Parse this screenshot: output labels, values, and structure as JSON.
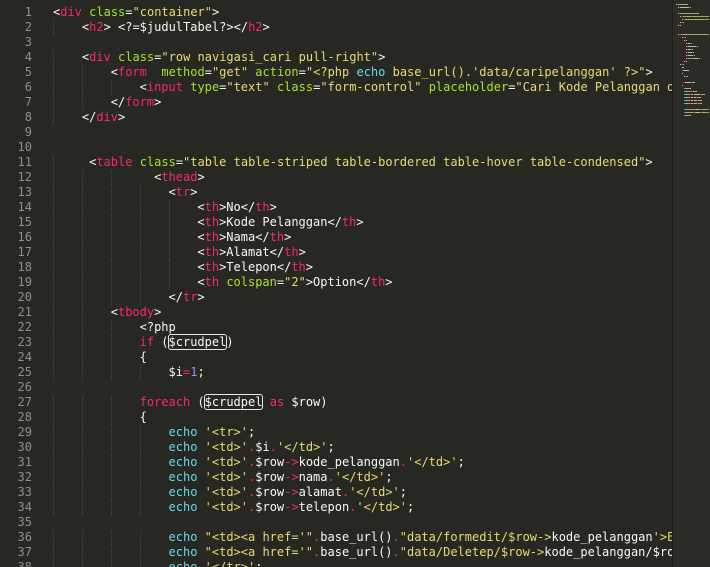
{
  "editor": {
    "lines": [
      {
        "n": "1",
        "indent": 0,
        "tokens": [
          [
            "p",
            "<"
          ],
          [
            "t",
            "div"
          ],
          [
            "p",
            " "
          ],
          [
            "a",
            "class"
          ],
          [
            "p",
            "="
          ],
          [
            "s",
            "\"container\""
          ],
          [
            "p",
            ">"
          ]
        ]
      },
      {
        "n": "2",
        "indent": 1,
        "tokens": [
          [
            "p",
            "<"
          ],
          [
            "t",
            "h2"
          ],
          [
            "p",
            "> <?=$judulTabel?></"
          ],
          [
            "t",
            "h2"
          ],
          [
            "p",
            ">"
          ]
        ]
      },
      {
        "n": "3",
        "indent": 0,
        "tokens": []
      },
      {
        "n": "4",
        "indent": 1,
        "tokens": [
          [
            "p",
            "<"
          ],
          [
            "t",
            "div"
          ],
          [
            "p",
            " "
          ],
          [
            "a",
            "class"
          ],
          [
            "p",
            "="
          ],
          [
            "s",
            "\"row navigasi_cari pull-right\""
          ],
          [
            "p",
            ">"
          ]
        ]
      },
      {
        "n": "5",
        "indent": 2,
        "tokens": [
          [
            "p",
            "<"
          ],
          [
            "t",
            "form"
          ],
          [
            "p",
            "  "
          ],
          [
            "a",
            "method"
          ],
          [
            "p",
            "="
          ],
          [
            "s",
            "\"get\""
          ],
          [
            "p",
            " "
          ],
          [
            "a",
            "action"
          ],
          [
            "p",
            "="
          ],
          [
            "s",
            "\"<?php "
          ],
          [
            "k",
            "echo"
          ],
          [
            "s",
            " base_url().'data/caripelanggan' ?>\""
          ],
          [
            "p",
            ">"
          ]
        ]
      },
      {
        "n": "6",
        "indent": 3,
        "tokens": [
          [
            "p",
            "<"
          ],
          [
            "t",
            "input"
          ],
          [
            "p",
            " "
          ],
          [
            "a",
            "type"
          ],
          [
            "p",
            "="
          ],
          [
            "s",
            "\"text\""
          ],
          [
            "p",
            " "
          ],
          [
            "a",
            "class"
          ],
          [
            "p",
            "="
          ],
          [
            "s",
            "\"form-control\""
          ],
          [
            "p",
            " "
          ],
          [
            "a",
            "placeholder"
          ],
          [
            "p",
            "="
          ],
          [
            "s",
            "\"Cari Kode Pelanggan di s"
          ]
        ]
      },
      {
        "n": "7",
        "indent": 2,
        "tokens": [
          [
            "p",
            "</"
          ],
          [
            "t",
            "form"
          ],
          [
            "p",
            ">"
          ]
        ]
      },
      {
        "n": "8",
        "indent": 1,
        "tokens": [
          [
            "p",
            "</"
          ],
          [
            "t",
            "div"
          ],
          [
            "p",
            ">"
          ]
        ]
      },
      {
        "n": "9",
        "indent": 0,
        "tokens": []
      },
      {
        "n": "10",
        "indent": 0,
        "tokens": []
      },
      {
        "n": "11",
        "indent": 1,
        "tokens": [
          [
            "p",
            " <"
          ],
          [
            "t",
            "table"
          ],
          [
            "p",
            " "
          ],
          [
            "a",
            "class"
          ],
          [
            "p",
            "="
          ],
          [
            "s",
            "\"table table-striped table-bordered table-hover table-condensed\""
          ],
          [
            "p",
            ">"
          ]
        ]
      },
      {
        "n": "12",
        "indent": 3,
        "tokens": [
          [
            "p",
            "  <"
          ],
          [
            "t",
            "thead"
          ],
          [
            "p",
            ">"
          ]
        ]
      },
      {
        "n": "13",
        "indent": 4,
        "tokens": [
          [
            "p",
            "<"
          ],
          [
            "t",
            "tr"
          ],
          [
            "p",
            ">"
          ]
        ]
      },
      {
        "n": "14",
        "indent": 5,
        "tokens": [
          [
            "p",
            "<"
          ],
          [
            "t",
            "th"
          ],
          [
            "p",
            ">No</"
          ],
          [
            "t",
            "th"
          ],
          [
            "p",
            ">"
          ]
        ]
      },
      {
        "n": "15",
        "indent": 5,
        "tokens": [
          [
            "p",
            "<"
          ],
          [
            "t",
            "th"
          ],
          [
            "p",
            ">Kode Pelanggan</"
          ],
          [
            "t",
            "th"
          ],
          [
            "p",
            ">"
          ]
        ]
      },
      {
        "n": "16",
        "indent": 5,
        "tokens": [
          [
            "p",
            "<"
          ],
          [
            "t",
            "th"
          ],
          [
            "p",
            ">Nama</"
          ],
          [
            "t",
            "th"
          ],
          [
            "p",
            ">"
          ]
        ]
      },
      {
        "n": "17",
        "indent": 5,
        "tokens": [
          [
            "p",
            "<"
          ],
          [
            "t",
            "th"
          ],
          [
            "p",
            ">Alamat</"
          ],
          [
            "t",
            "th"
          ],
          [
            "p",
            ">"
          ]
        ]
      },
      {
        "n": "18",
        "indent": 5,
        "tokens": [
          [
            "p",
            "<"
          ],
          [
            "t",
            "th"
          ],
          [
            "p",
            ">Telepon</"
          ],
          [
            "t",
            "th"
          ],
          [
            "p",
            ">"
          ]
        ]
      },
      {
        "n": "19",
        "indent": 5,
        "tokens": [
          [
            "p",
            "<"
          ],
          [
            "t",
            "th"
          ],
          [
            "p",
            " "
          ],
          [
            "a",
            "colspan"
          ],
          [
            "p",
            "="
          ],
          [
            "s",
            "\"2\""
          ],
          [
            "p",
            ">Option</"
          ],
          [
            "t",
            "th"
          ],
          [
            "p",
            ">"
          ]
        ]
      },
      {
        "n": "20",
        "indent": 4,
        "tokens": [
          [
            "p",
            "</"
          ],
          [
            "t",
            "tr"
          ],
          [
            "p",
            ">"
          ]
        ]
      },
      {
        "n": "21",
        "indent": 2,
        "tokens": [
          [
            "p",
            "<"
          ],
          [
            "t",
            "tbody"
          ],
          [
            "p",
            ">"
          ]
        ]
      },
      {
        "n": "22",
        "indent": 3,
        "tokens": [
          [
            "p",
            "<?php"
          ]
        ]
      },
      {
        "n": "23",
        "indent": 3,
        "tokens": [
          [
            "t",
            "if"
          ],
          [
            "p",
            " ("
          ],
          [
            "pb",
            "$crudpel"
          ],
          [
            "p",
            ")"
          ]
        ]
      },
      {
        "n": "24",
        "indent": 3,
        "tokens": [
          [
            "p",
            "{"
          ]
        ]
      },
      {
        "n": "25",
        "indent": 4,
        "tokens": [
          [
            "p",
            "$i"
          ],
          [
            "t",
            "="
          ],
          [
            "n",
            "1"
          ],
          [
            "p",
            ";"
          ]
        ]
      },
      {
        "n": "26",
        "indent": 0,
        "tokens": []
      },
      {
        "n": "27",
        "indent": 3,
        "tokens": [
          [
            "t",
            "foreach"
          ],
          [
            "p",
            " ("
          ],
          [
            "pb",
            "$crudpel"
          ],
          [
            "p",
            " "
          ],
          [
            "t",
            "as"
          ],
          [
            "p",
            " $row)"
          ]
        ]
      },
      {
        "n": "28",
        "indent": 3,
        "tokens": [
          [
            "p",
            "{"
          ]
        ]
      },
      {
        "n": "29",
        "indent": 4,
        "tokens": [
          [
            "k",
            "echo"
          ],
          [
            "p",
            " "
          ],
          [
            "s",
            "'<tr>'"
          ],
          [
            "p",
            ";"
          ]
        ]
      },
      {
        "n": "30",
        "indent": 4,
        "tokens": [
          [
            "k",
            "echo"
          ],
          [
            "p",
            " "
          ],
          [
            "s",
            "'<td>'"
          ],
          [
            "t",
            "."
          ],
          [
            "p",
            "$i"
          ],
          [
            "t",
            "."
          ],
          [
            "s",
            "'</td>'"
          ],
          [
            "p",
            ";"
          ]
        ]
      },
      {
        "n": "31",
        "indent": 4,
        "tokens": [
          [
            "k",
            "echo"
          ],
          [
            "p",
            " "
          ],
          [
            "s",
            "'<td>'"
          ],
          [
            "t",
            "."
          ],
          [
            "p",
            "$row"
          ],
          [
            "t",
            "->"
          ],
          [
            "p",
            "kode_pelanggan"
          ],
          [
            "t",
            "."
          ],
          [
            "s",
            "'</td>'"
          ],
          [
            "p",
            ";"
          ]
        ]
      },
      {
        "n": "32",
        "indent": 4,
        "tokens": [
          [
            "k",
            "echo"
          ],
          [
            "p",
            " "
          ],
          [
            "s",
            "'<td>'"
          ],
          [
            "t",
            "."
          ],
          [
            "p",
            "$row"
          ],
          [
            "t",
            "->"
          ],
          [
            "p",
            "nama"
          ],
          [
            "t",
            "."
          ],
          [
            "s",
            "'</td>'"
          ],
          [
            "p",
            ";"
          ]
        ]
      },
      {
        "n": "33",
        "indent": 4,
        "tokens": [
          [
            "k",
            "echo"
          ],
          [
            "p",
            " "
          ],
          [
            "s",
            "'<td>'"
          ],
          [
            "t",
            "."
          ],
          [
            "p",
            "$row"
          ],
          [
            "t",
            "->"
          ],
          [
            "p",
            "alamat"
          ],
          [
            "t",
            "."
          ],
          [
            "s",
            "'</td>'"
          ],
          [
            "p",
            ";"
          ]
        ]
      },
      {
        "n": "34",
        "indent": 4,
        "tokens": [
          [
            "k",
            "echo"
          ],
          [
            "p",
            " "
          ],
          [
            "s",
            "'<td>'"
          ],
          [
            "t",
            "."
          ],
          [
            "p",
            "$row"
          ],
          [
            "t",
            "->"
          ],
          [
            "p",
            "telepon"
          ],
          [
            "t",
            "."
          ],
          [
            "s",
            "'</td>'"
          ],
          [
            "p",
            ";"
          ]
        ]
      },
      {
        "n": "35",
        "indent": 0,
        "tokens": []
      },
      {
        "n": "36",
        "indent": 4,
        "tokens": [
          [
            "k",
            "echo"
          ],
          [
            "p",
            " "
          ],
          [
            "s",
            "\"<td><a href='\""
          ],
          [
            "t",
            "."
          ],
          [
            "p",
            "base_url()"
          ],
          [
            "t",
            "."
          ],
          [
            "s",
            "\"data/formedit/$row->"
          ],
          [
            "p",
            "kode_pelanggan"
          ],
          [
            "s",
            "'>Edit"
          ]
        ]
      },
      {
        "n": "37",
        "indent": 4,
        "tokens": [
          [
            "k",
            "echo"
          ],
          [
            "p",
            " "
          ],
          [
            "s",
            "\"<td><a href='\""
          ],
          [
            "t",
            "."
          ],
          [
            "p",
            "base_url()"
          ],
          [
            "t",
            "."
          ],
          [
            "s",
            "\"data/Deletep/$row->"
          ],
          [
            "p",
            "kode_pelanggan/$row->"
          ]
        ]
      },
      {
        "n": "38",
        "indent": 4,
        "tokens": [
          [
            "k",
            "echo"
          ],
          [
            "p",
            " "
          ],
          [
            "s",
            "'</tr>'"
          ],
          [
            "p",
            ";"
          ]
        ]
      }
    ]
  },
  "colors": {
    "background": "#272822",
    "line_number": "#90908a",
    "tag": "#f92672",
    "attribute": "#a6e22e",
    "string": "#e6db74",
    "keyword": "#66d9ef",
    "number": "#ae81ff",
    "text": "#f8f8f2"
  }
}
